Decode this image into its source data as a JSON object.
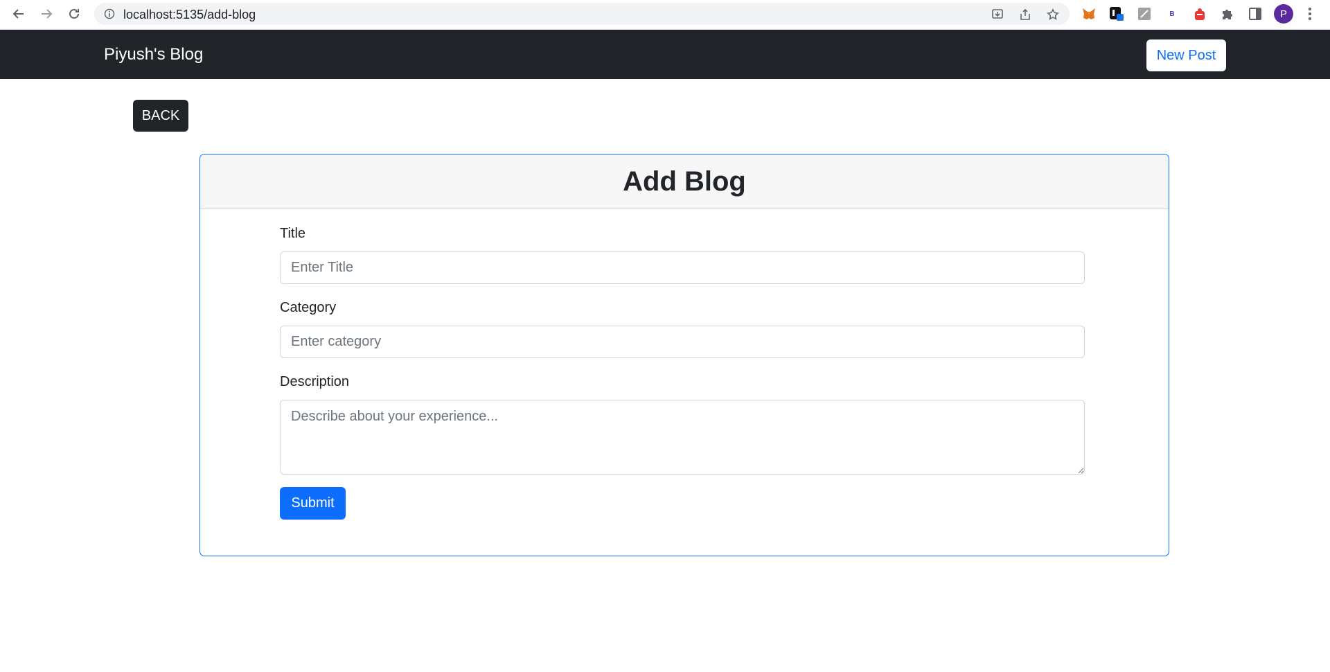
{
  "browser": {
    "url": "localhost:5135/add-blog",
    "avatar_letter": "P",
    "extension_b_label": "B",
    "icons": [
      "back-arrow-icon",
      "forward-arrow-icon",
      "reload-icon",
      "site-info-icon",
      "install-icon",
      "share-icon",
      "bookmark-star-icon",
      "metamask-fox-icon",
      "extension-icon",
      "extension-icon",
      "extension-icon",
      "extension-icon",
      "puzzle-extensions-icon",
      "side-panel-icon",
      "kebab-menu-icon"
    ]
  },
  "navbar": {
    "brand": "Piyush's Blog",
    "new_post_label": "New Post"
  },
  "back_label": "BACK",
  "card": {
    "title": "Add Blog",
    "fields": {
      "title_label": "Title",
      "title_placeholder": "Enter Title",
      "title_value": "",
      "category_label": "Category",
      "category_placeholder": "Enter category",
      "category_value": "",
      "description_label": "Description",
      "description_placeholder": "Describe about your experience...",
      "description_value": ""
    },
    "submit_label": "Submit"
  },
  "colors": {
    "navbar_bg": "#212529",
    "primary": "#0d6efd",
    "card_header_bg": "#f7f7f7"
  }
}
